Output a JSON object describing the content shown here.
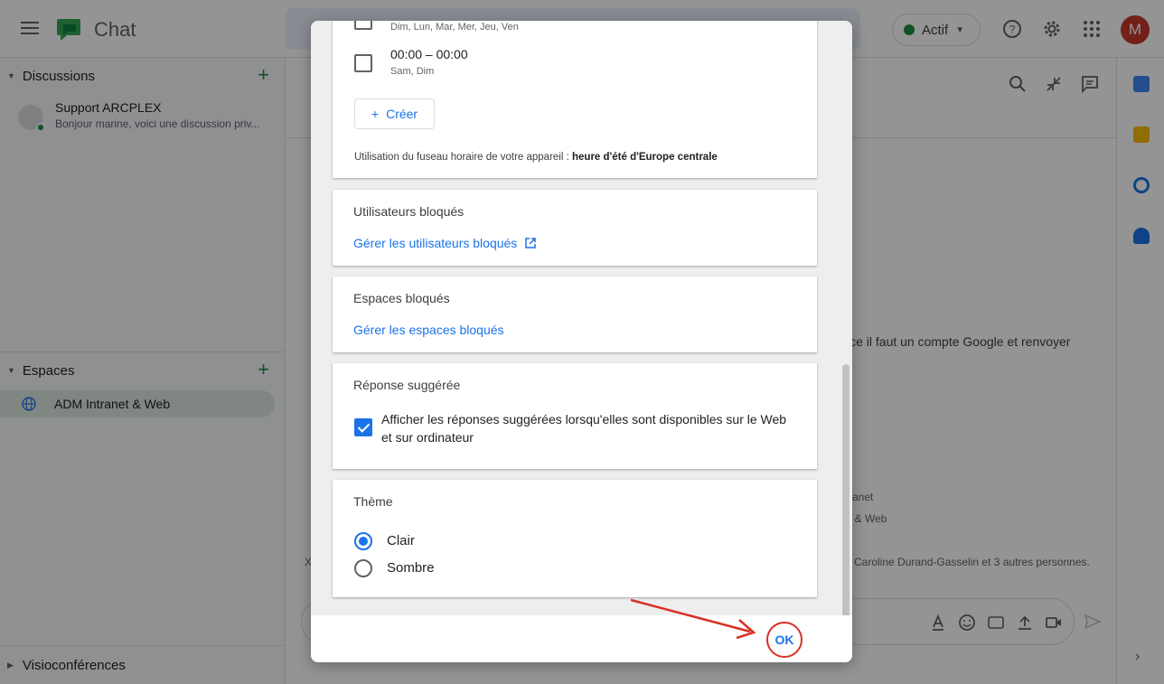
{
  "app": {
    "title": "Chat",
    "status_label": "Actif",
    "avatar_initial": "M"
  },
  "sidebar": {
    "discussions_label": "Discussions",
    "conversation": {
      "name": "Support ARCPLEX",
      "preview": "Bonjour marine, voici une discussion priv..."
    },
    "spaces_label": "Espaces",
    "space_item": "ADM Intranet & Web",
    "meetings_label": "Visioconférences"
  },
  "background": {
    "message_fragment": "ice il faut un compte Google et renvoyer",
    "fragment_1": "ranet",
    "fragment_2": "t & Web",
    "fragment_3": "Caroline Durand-Gasselin et 3 autres personnes.",
    "fragment_x": "X"
  },
  "dialog": {
    "schedule": {
      "row1_days": "Dim, Lun, Mar, Mer, Jeu, Ven",
      "row2_time": "00:00 – 00:00",
      "row2_days": "Sam, Dim",
      "create_label": "Créer",
      "timezone_prefix": "Utilisation du fuseau horaire de votre appareil :",
      "timezone_name": "heure d'été d'Europe centrale"
    },
    "blocked_users": {
      "title": "Utilisateurs bloqués",
      "link": "Gérer les utilisateurs bloqués"
    },
    "blocked_spaces": {
      "title": "Espaces bloqués",
      "link": "Gérer les espaces bloqués"
    },
    "suggested_reply": {
      "title": "Réponse suggérée",
      "checkbox_label": "Afficher les réponses suggérées lorsqu'elles sont disponibles sur le Web et sur ordinateur",
      "checked": true
    },
    "theme": {
      "title": "Thème",
      "options": [
        "Clair",
        "Sombre"
      ],
      "selected": "Clair"
    },
    "ok_label": "OK"
  },
  "colors": {
    "accent": "#1a73e8",
    "annotation": "#d93025",
    "online": "#1e8e3e"
  }
}
